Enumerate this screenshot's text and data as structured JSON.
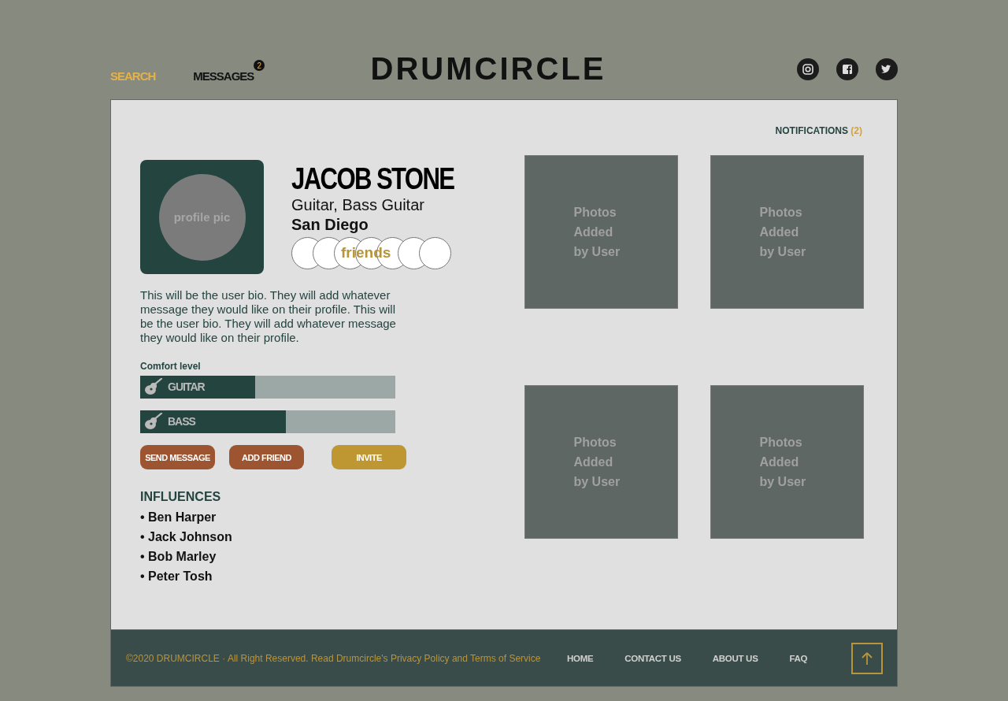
{
  "nav": [
    {
      "label": "SEARCH",
      "selected": true
    },
    {
      "label": "MESSAGES",
      "selected": false,
      "badge": "2"
    }
  ],
  "logo": "DRUMCIRCLE",
  "notifications": {
    "label": "NOTIFICATIONS",
    "count": "(2)"
  },
  "profile": {
    "picture_label": "profile pic",
    "name": "JACOB STONE",
    "instruments": "Guitar, Bass Guitar",
    "location": "San Diego",
    "friends_label": "friends",
    "bio": "This will be the user bio. They will add whatever message they would like on their profile. This will be the user bio. They will add whatever message they would like on their profile."
  },
  "comfort": {
    "title": "Comfort level",
    "skills": [
      {
        "name": "GUITAR",
        "level": 0.45
      },
      {
        "name": "BASS",
        "level": 0.57
      }
    ]
  },
  "buttons": [
    {
      "label": "SEND MESSAGE",
      "kind": "primary"
    },
    {
      "label": "ADD FRIEND",
      "kind": "primary"
    },
    {
      "label": "INVITE",
      "kind": "accent"
    }
  ],
  "influences": {
    "title": "INFLUENCES",
    "items": [
      "• Ben Harper",
      "• Jack Johnson",
      "• Bob Marley",
      "• Peter Tosh"
    ]
  },
  "photos": [
    "Photos Added by User",
    "Photos Added by User",
    "Photos Added by User",
    "Photos Added by User"
  ],
  "footer": {
    "copyright": "©2020 DRUMCIRCLE · All Right Reserved. Read Drumcircle's Privacy Policy and Terms of Service",
    "links": [
      "HOME",
      "CONTACT US",
      "ABOUT US",
      "FAQ"
    ]
  }
}
